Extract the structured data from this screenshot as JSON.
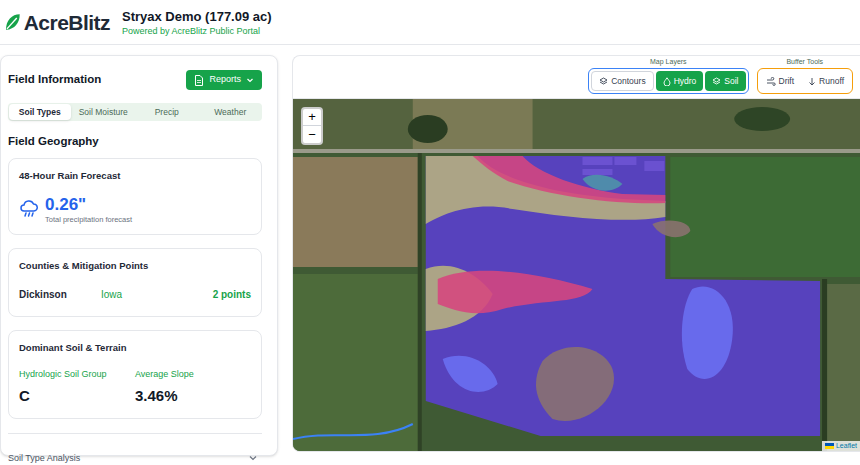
{
  "header": {
    "logo": "AcreBlitz",
    "title": "Stryax Demo (177.09 ac)",
    "subtitle": "Powered by AcreBlitz Public Portal"
  },
  "sidebar": {
    "title": "Field Information",
    "reports_button": "Reports",
    "tabs": [
      {
        "label": "Soil Types",
        "selected": true
      },
      {
        "label": "Soil Moisture",
        "selected": false
      },
      {
        "label": "Precip",
        "selected": false
      },
      {
        "label": "Weather",
        "selected": false
      }
    ],
    "section_title": "Field Geography",
    "rain": {
      "title": "48-Hour Rain Forecast",
      "value": "0.26\"",
      "caption": "Total precipitation forecast"
    },
    "counties": {
      "title": "Counties & Mitigation Points",
      "county": "Dickinson",
      "state": "Iowa",
      "points": "2 points"
    },
    "soil": {
      "title": "Dominant Soil & Terrain",
      "stats": [
        {
          "label": "Hydrologic Soil Group",
          "value": "C"
        },
        {
          "label": "Average Slope",
          "value": "3.46%"
        }
      ]
    },
    "analysis": {
      "title": "Soil Type Analysis",
      "expanded": false
    }
  },
  "map": {
    "layers_label": "Map Layers",
    "layers": [
      {
        "label": "Contours",
        "selected": false
      },
      {
        "label": "Hydro",
        "selected": true
      },
      {
        "label": "Soil",
        "selected": true
      }
    ],
    "buffer_label": "Buffer Tools",
    "buffers": [
      {
        "label": "Drift",
        "selected": false
      },
      {
        "label": "Runoff",
        "selected": false
      }
    ],
    "zoom": [
      "+",
      "−"
    ],
    "attribution": "Leaflet",
    "soil_units": [
      {
        "color": "#5b3fd0"
      },
      {
        "color": "#b8b27e"
      },
      {
        "color": "#d6457e"
      },
      {
        "color": "#4f95a8"
      },
      {
        "color": "#8b7270"
      },
      {
        "color": "#6b6ff2"
      }
    ]
  }
}
